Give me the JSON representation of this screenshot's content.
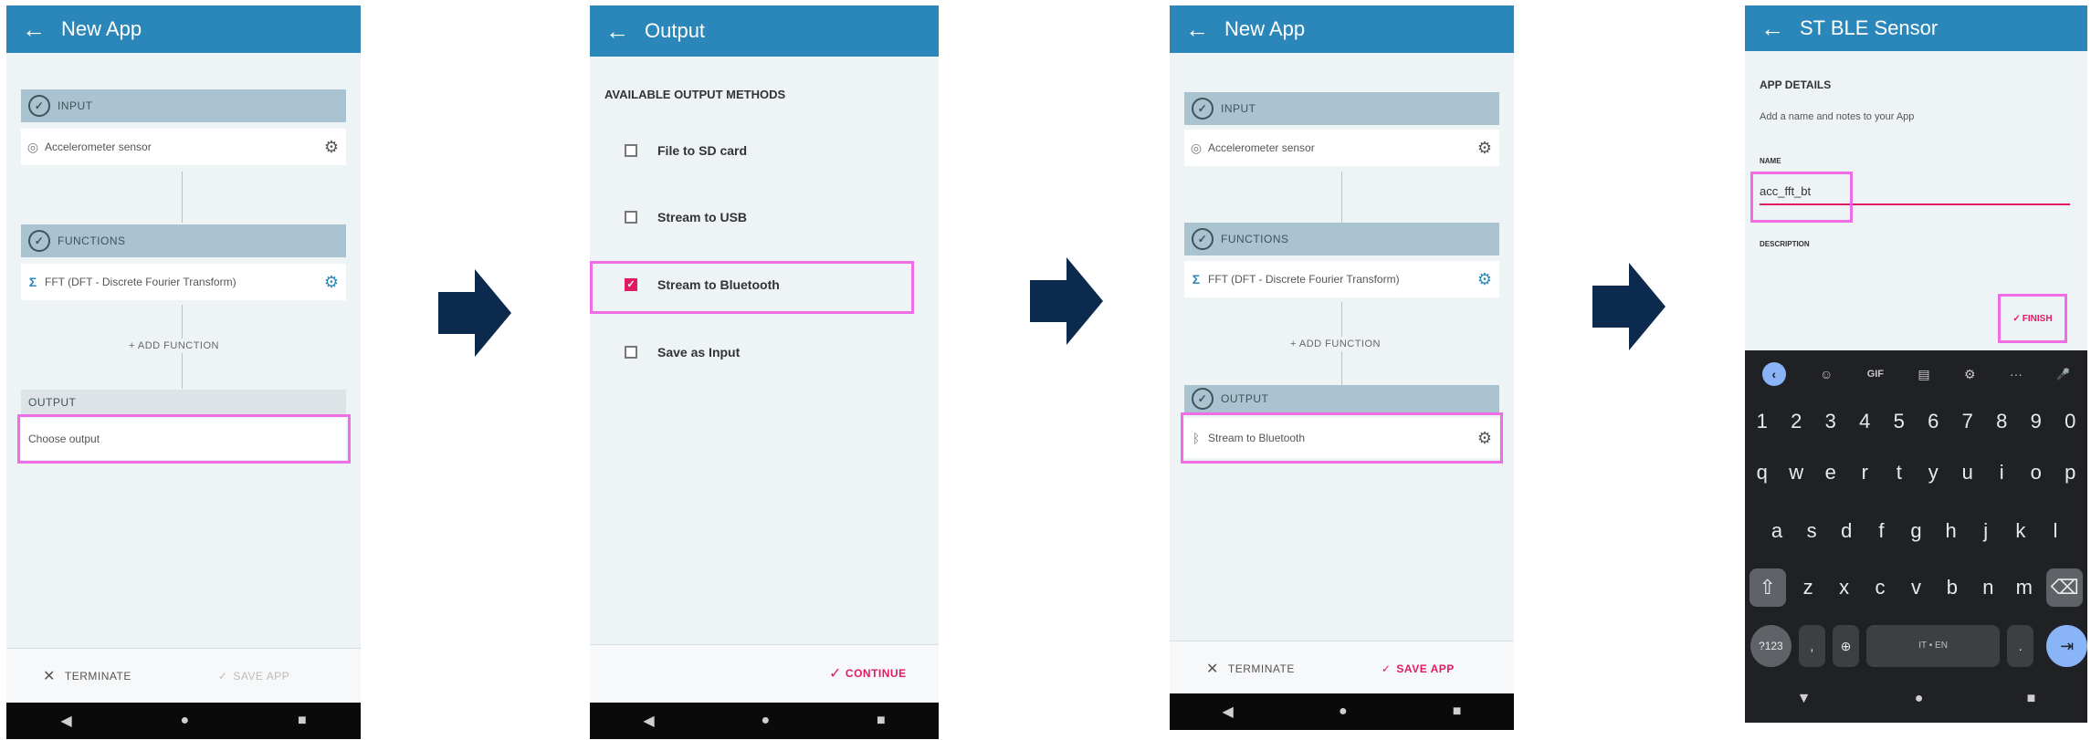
{
  "screen1": {
    "title": "New App",
    "back": "←",
    "input_header": "INPUT",
    "input_item": "Accelerometer sensor",
    "functions_header": "FUNCTIONS",
    "function_item": "FFT (DFT - Discrete Fourier Transform)",
    "add_function": "+ ADD FUNCTION",
    "output_header": "OUTPUT",
    "output_item": "Choose output",
    "terminate": "TERMINATE",
    "save_app": "SAVE APP"
  },
  "screen2": {
    "title": "Output",
    "back": "←",
    "section": "AVAILABLE OUTPUT METHODS",
    "options": [
      {
        "label": "File to SD card",
        "checked": false
      },
      {
        "label": "Stream to USB",
        "checked": false
      },
      {
        "label": "Stream to Bluetooth",
        "checked": true
      },
      {
        "label": "Save as Input",
        "checked": false
      }
    ],
    "continue": "CONTINUE"
  },
  "screen3": {
    "title": "New App",
    "back": "←",
    "input_header": "INPUT",
    "input_item": "Accelerometer sensor",
    "functions_header": "FUNCTIONS",
    "function_item": "FFT (DFT - Discrete Fourier Transform)",
    "add_function": "+ ADD FUNCTION",
    "output_header": "OUTPUT",
    "output_item": "Stream to Bluetooth",
    "terminate": "TERMINATE",
    "save_app": "SAVE APP"
  },
  "screen4": {
    "title": "ST BLE Sensor",
    "back": "←",
    "section": "APP DETAILS",
    "subtitle": "Add a name and notes to your App",
    "name_label": "NAME",
    "name_value": "acc_fft_bt",
    "description_label": "DESCRIPTION",
    "finish": "FINISH",
    "keyboard": {
      "top": [
        "‹",
        "☺",
        "GIF",
        "▤",
        "⚙",
        "···",
        "🎤"
      ],
      "numbers": [
        "1",
        "2",
        "3",
        "4",
        "5",
        "6",
        "7",
        "8",
        "9",
        "0"
      ],
      "row1": [
        "q",
        "w",
        "e",
        "r",
        "t",
        "y",
        "u",
        "i",
        "o",
        "p"
      ],
      "row2": [
        "a",
        "s",
        "d",
        "f",
        "g",
        "h",
        "j",
        "k",
        "l"
      ],
      "row3": [
        "⇧",
        "z",
        "x",
        "c",
        "v",
        "b",
        "n",
        "m",
        "⌫"
      ],
      "sym": "?123",
      "space": "IT • EN",
      "enter": "⇥"
    }
  },
  "colors": {
    "appbar": "#2b87b9",
    "accent": "#e21a63",
    "highlight": "#ef6ee8",
    "arrow": "#0c2a4e"
  }
}
